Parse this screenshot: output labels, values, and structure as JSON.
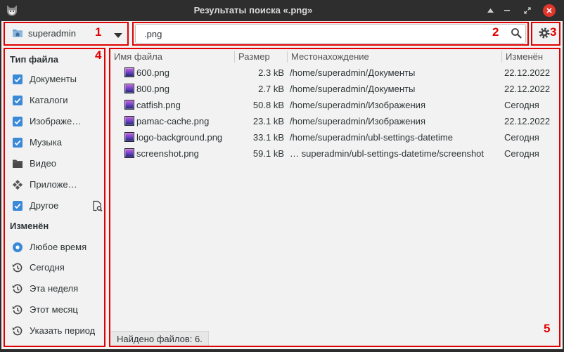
{
  "window": {
    "title": "Результаты поиска «.png»",
    "app_icon": "catfish-icon",
    "controls": {
      "shade_icon": "shade-icon",
      "minimize_icon": "minimize-icon",
      "maximize_icon": "maximize-icon",
      "close_icon": "close-icon"
    }
  },
  "toolbar": {
    "location": {
      "icon": "home-folder-icon",
      "value": "superadmin",
      "dropdown_icon": "chevron-down-icon"
    },
    "search": {
      "value": ".png",
      "icon": "search-icon"
    },
    "settings": {
      "icon": "gear-icon"
    }
  },
  "sidebar": {
    "file_type_heading": "Тип файла",
    "file_types": [
      {
        "label": "Документы",
        "checked": true
      },
      {
        "label": "Каталоги",
        "checked": true
      },
      {
        "label": "Изображе…",
        "checked": true
      },
      {
        "label": "Музыка",
        "checked": true
      },
      {
        "label": "Видео",
        "checked": false,
        "icon": "video-folder-icon"
      },
      {
        "label": "Приложе…",
        "checked": false,
        "icon": "applications-icon"
      },
      {
        "label": "Другое",
        "checked": true,
        "extra_icon": "document-search-icon"
      }
    ],
    "modified_heading": "Изменён",
    "modified_options": [
      {
        "label": "Любое время",
        "selected": true
      },
      {
        "label": "Сегодня",
        "selected": false,
        "icon": "history-icon"
      },
      {
        "label": "Эта неделя",
        "selected": false,
        "icon": "history-icon"
      },
      {
        "label": "Этот месяц",
        "selected": false,
        "icon": "history-icon"
      },
      {
        "label": "Указать период",
        "selected": false,
        "icon": "history-icon"
      }
    ]
  },
  "results": {
    "columns": {
      "name": "Имя файла",
      "size": "Размер",
      "location": "Местонахождение",
      "modified": "Изменён"
    },
    "rows": [
      {
        "icon": "image-file-icon",
        "name": "600.png",
        "size": "2.3 kB",
        "location": "/home/superadmin/Документы",
        "modified": "22.12.2022"
      },
      {
        "icon": "image-file-icon",
        "name": "800.png",
        "size": "2.7 kB",
        "location": "/home/superadmin/Документы",
        "modified": "22.12.2022"
      },
      {
        "icon": "image-file-icon",
        "name": "catfish.png",
        "size": "50.8 kB",
        "location": "/home/superadmin/Изображения",
        "modified": "Сегодня"
      },
      {
        "icon": "image-file-icon",
        "name": "pamac-cache.png",
        "size": "23.1 kB",
        "location": "/home/superadmin/Изображения",
        "modified": "22.12.2022"
      },
      {
        "icon": "image-file-icon",
        "name": "logo-background.png",
        "size": "33.1 kB",
        "location": "/home/superadmin/ubl-settings-datetime",
        "modified": "Сегодня"
      },
      {
        "icon": "image-file-icon",
        "name": "screenshot.png",
        "size": "59.1 kB",
        "location": "… superadmin/ubl-settings-datetime/screenshot",
        "modified": "Сегодня"
      }
    ],
    "status": "Найдено файлов: 6."
  },
  "annotations": [
    "1",
    "2",
    "3",
    "4",
    "5"
  ],
  "colors": {
    "accent": "#3b8ad8",
    "annotation": "#e00000",
    "titlebar": "#2e2e2e",
    "close_button": "#e0362c",
    "background": "#f2f2f2"
  }
}
